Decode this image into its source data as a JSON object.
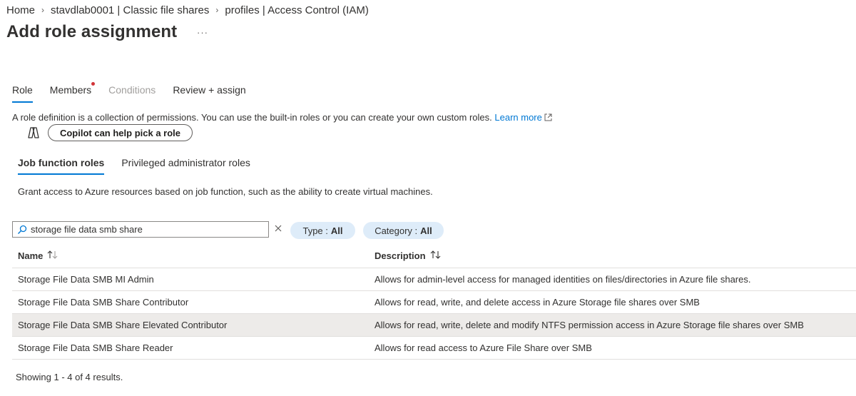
{
  "breadcrumb": {
    "items": [
      "Home",
      "stavdlab0001 | Classic file shares",
      "profiles | Access Control (IAM)"
    ]
  },
  "page": {
    "title": "Add role assignment",
    "more_label": "···"
  },
  "tabs": [
    {
      "label": "Role",
      "state": "active"
    },
    {
      "label": "Members",
      "state": "required"
    },
    {
      "label": "Conditions",
      "state": "disabled"
    },
    {
      "label": "Review + assign",
      "state": "normal"
    }
  ],
  "intro": {
    "text": "A role definition is a collection of permissions. You can use the built-in roles or you can create your own custom roles.",
    "learn_more": "Learn more"
  },
  "copilot": {
    "button_label": "Copilot can help pick a role",
    "icon": "copilot-icon"
  },
  "subtabs": [
    {
      "label": "Job function roles",
      "active": true
    },
    {
      "label": "Privileged administrator roles",
      "active": false
    }
  ],
  "grant_text": "Grant access to Azure resources based on job function, such as the ability to create virtual machines.",
  "search": {
    "value": "storage file data smb share",
    "placeholder": ""
  },
  "filters": {
    "type": {
      "label": "Type :",
      "value": "All"
    },
    "category": {
      "label": "Category :",
      "value": "All"
    }
  },
  "table": {
    "columns": [
      "Name",
      "Description"
    ],
    "rows": [
      {
        "name": "Storage File Data SMB MI Admin",
        "description": "Allows for admin-level access for managed identities on files/directories in Azure file shares.",
        "selected": false
      },
      {
        "name": "Storage File Data SMB Share Contributor",
        "description": "Allows for read, write, and delete access in Azure Storage file shares over SMB",
        "selected": false
      },
      {
        "name": "Storage File Data SMB Share Elevated Contributor",
        "description": "Allows for read, write, delete and modify NTFS permission access in Azure Storage file shares over SMB",
        "selected": true
      },
      {
        "name": "Storage File Data SMB Share Reader",
        "description": "Allows for read access to Azure File Share over SMB",
        "selected": false
      }
    ]
  },
  "results_text": "Showing 1 - 4 of 4 results.",
  "colors": {
    "accent": "#0078d4",
    "pill_bg": "#deecf9",
    "required_dot": "#d13438",
    "selected_row": "#edebe9"
  }
}
